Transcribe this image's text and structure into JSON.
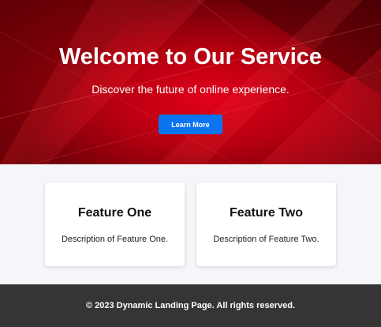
{
  "hero": {
    "title": "Welcome to Our Service",
    "subtitle": "Discover the future of online experience.",
    "cta_label": "Learn More",
    "background_color": "#b4000f",
    "cta_color": "#0b74f0"
  },
  "features": [
    {
      "title": "Feature One",
      "description": "Description of Feature One."
    },
    {
      "title": "Feature Two",
      "description": "Description of Feature Two."
    }
  ],
  "footer": {
    "text": "© 2023 Dynamic Landing Page. All rights reserved.",
    "background_color": "#353535"
  }
}
